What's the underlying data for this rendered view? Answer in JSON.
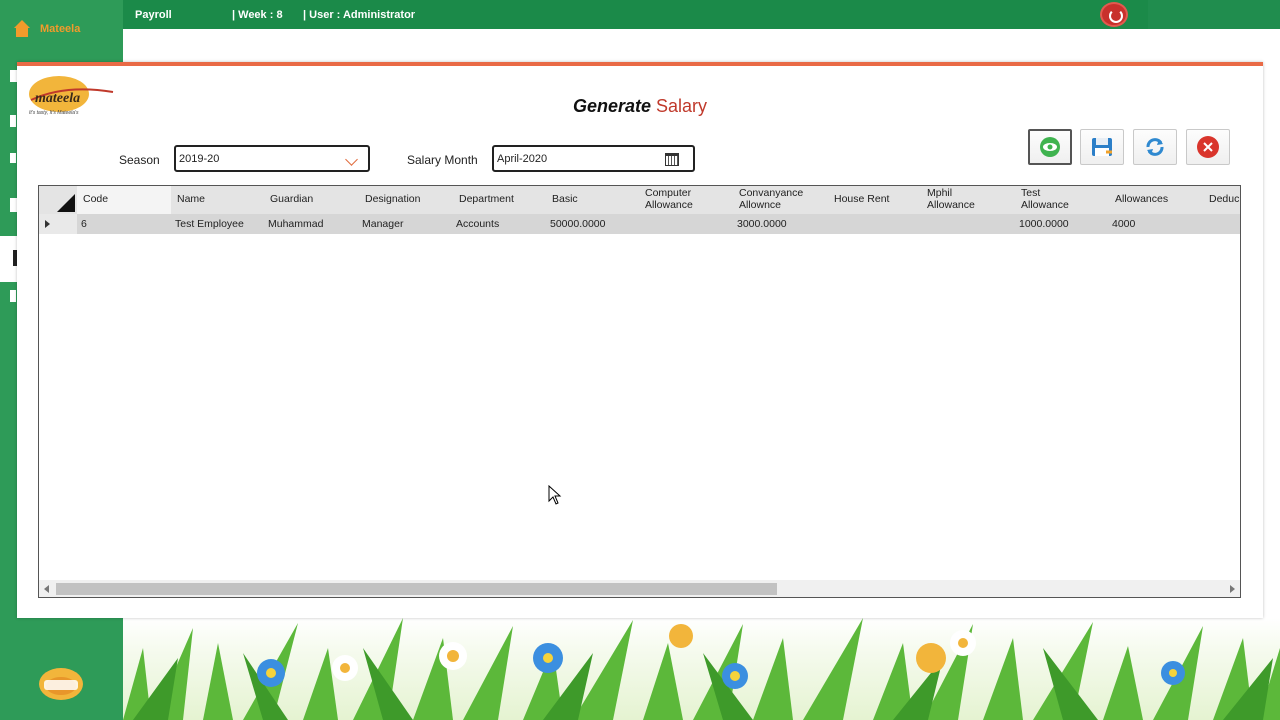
{
  "topbar": {
    "module": "Payroll",
    "week": "| Week : 8",
    "user": "| User : Administrator"
  },
  "sidebar": {
    "home_label": "Mateela"
  },
  "logo": {
    "brand": "mateela",
    "tagline": "It's tasty, It's Mateela's"
  },
  "page": {
    "title_part1": "Generate",
    "title_part2": "Salary"
  },
  "form": {
    "season_label": "Season",
    "season_value": "2019-20",
    "month_label": "Salary Month",
    "month_value": "April-2020"
  },
  "toolbar": {
    "buttons": [
      "view-icon",
      "save-icon",
      "refresh-icon",
      "close-icon"
    ],
    "colors": {
      "view": "#3fb34f",
      "save": "#2c7fc8",
      "refresh": "#2f89d0",
      "close": "#d9352c"
    }
  },
  "grid": {
    "columns": [
      "Code",
      "Name",
      "Guardian",
      "Designation",
      "Department",
      "Basic",
      "Computer Allowance",
      "Convanyance Allownce",
      "House Rent",
      "Mphil Allowance",
      "Test Allowance",
      "Allowances",
      "Deduc"
    ],
    "rows": [
      {
        "code": "6",
        "name": "Test Employee",
        "guardian": "Muhammad",
        "designation": "Manager",
        "department": "Accounts",
        "basic": "50000.0000",
        "computer_allowance": "",
        "conveyance_allowance": "3000.0000",
        "house_rent": "",
        "mphil_allowance": "",
        "test_allowance": "1000.0000",
        "allowances": "4000",
        "deduc": ""
      }
    ]
  },
  "colors": {
    "green": "#1e8a4c",
    "accent_orange": "#e96a46",
    "title_red": "#c0392b"
  }
}
